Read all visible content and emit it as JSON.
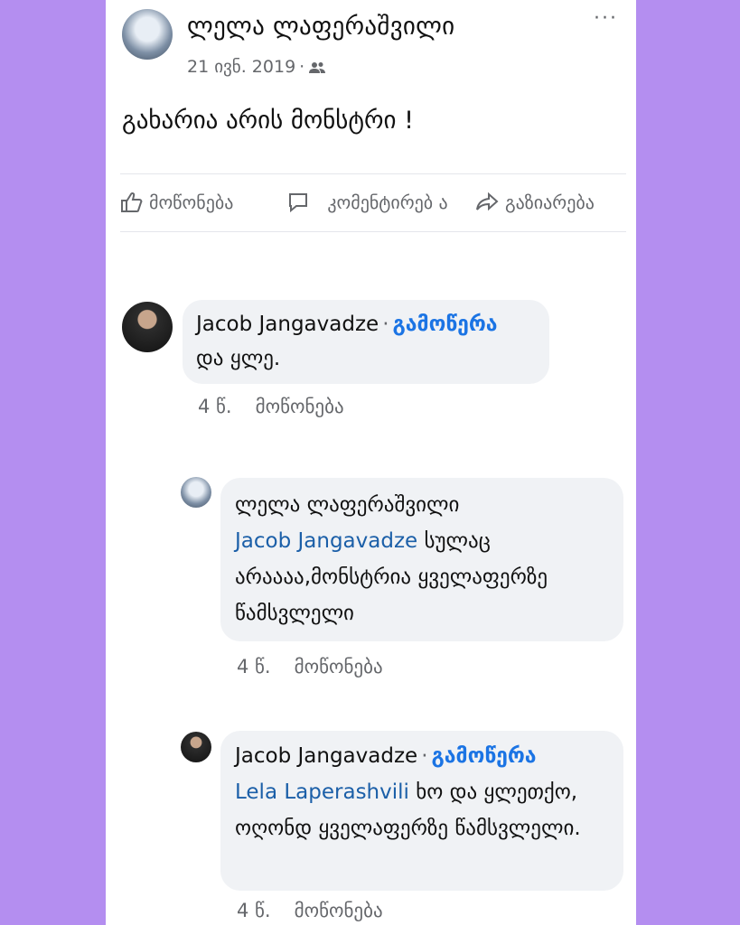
{
  "post": {
    "author": "ლელა ლაფერაშვილი",
    "date": "21 ივნ. 2019",
    "separator": "·",
    "text": "გახარია არის მონსტრი !",
    "more": "···"
  },
  "actions": {
    "like": "მოწონება",
    "comment": "კომენტირებ ა",
    "share": "გაზიარება"
  },
  "comments": [
    {
      "author": "Jacob Jangavadze",
      "follow": "გამოწერა",
      "tag": "",
      "text": "და ყლე.",
      "time": "4 წ.",
      "like": "მოწონება"
    },
    {
      "author": "ლელა ლაფერაშვილი",
      "follow": "",
      "tag": "Jacob Jangavadze",
      "text": "სულაც არაააა,მონსტრია ყველაფერზე წამსვლელი",
      "time": "4 წ.",
      "like": "მოწონება"
    },
    {
      "author": "Jacob Jangavadze",
      "follow": "გამოწერა",
      "tag": "Lela Laperashvili",
      "text": "ხო და ყლეთქო, ოღონდ ყველაფერზე წამსვლელი.",
      "time": "4 წ.",
      "like": "მოწონება"
    }
  ],
  "colors": {
    "background": "#b48ef0",
    "card": "#ffffff",
    "link": "#1b74e4",
    "bubble": "#f0f2f5"
  }
}
